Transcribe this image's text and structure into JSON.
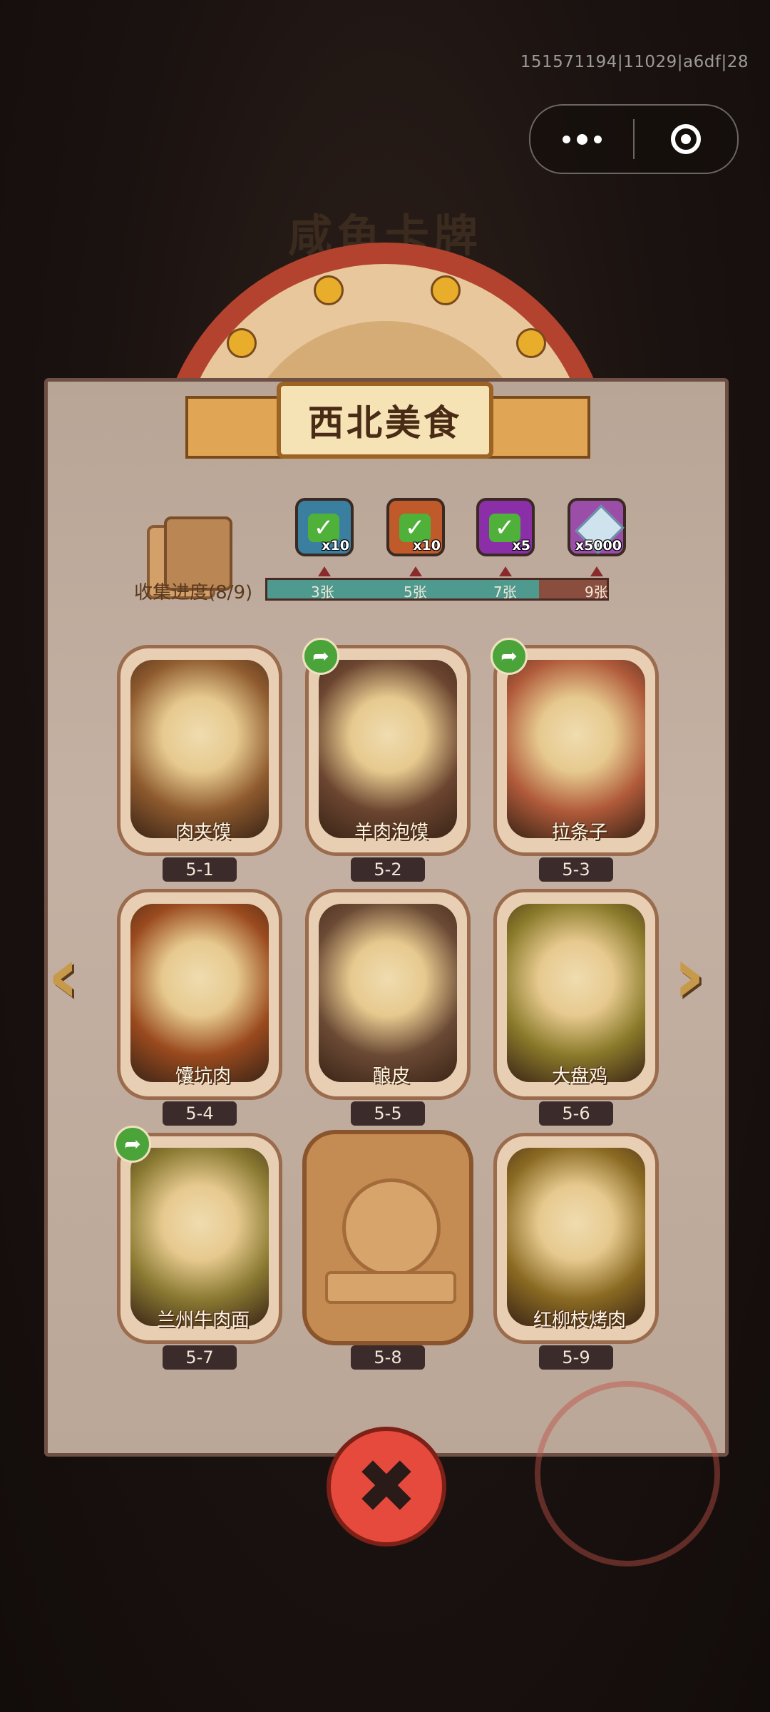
{
  "system": {
    "debug_id": "151571194|11029|a6df|28"
  },
  "capsule": {
    "more_icon": "more-dots-icon",
    "close_icon": "target-circle-icon"
  },
  "background": {
    "game_title": "咸鱼卡牌"
  },
  "panel": {
    "title": "西北美食"
  },
  "collection": {
    "label": "收集进度(8/9)",
    "collected": 8,
    "total": 9,
    "progress_fraction": 0.8,
    "rewards": [
      {
        "icon": "treasure-chest-icon",
        "qty": "x10",
        "claimed": true,
        "color": "#3a7fa0"
      },
      {
        "icon": "scroll-ticket-icon",
        "qty": "x10",
        "claimed": true,
        "color": "#c05a2a"
      },
      {
        "icon": "purple-orb-icon",
        "qty": "x5",
        "claimed": true,
        "color": "#8a2fa8"
      },
      {
        "icon": "crystal-gem-icon",
        "qty": "x5000",
        "claimed": false,
        "color": "#9a4ea8"
      }
    ],
    "milestones": [
      "3张",
      "5张",
      "7张",
      "9张"
    ]
  },
  "cards": [
    {
      "name": "肉夹馍",
      "num": "5-1",
      "shared": false,
      "color": "#8e5a2e"
    },
    {
      "name": "羊肉泡馍",
      "num": "5-2",
      "shared": true,
      "color": "#6b4530"
    },
    {
      "name": "拉条子",
      "num": "5-3",
      "shared": true,
      "color": "#b05a3a"
    },
    {
      "name": "馕坑肉",
      "num": "5-4",
      "shared": false,
      "color": "#9a4a1e"
    },
    {
      "name": "酿皮",
      "num": "5-5",
      "shared": false,
      "color": "#6b4a35"
    },
    {
      "name": "大盘鸡",
      "num": "5-6",
      "shared": false,
      "color": "#8a7a2a"
    },
    {
      "name": "兰州牛肉面",
      "num": "5-7",
      "shared": true,
      "color": "#8a7a32"
    },
    {
      "name": "",
      "num": "5-8",
      "shared": false,
      "locked": true,
      "color": "#c48b52"
    },
    {
      "name": "红柳枝烤肉",
      "num": "5-9",
      "shared": false,
      "color": "#8a6a22"
    }
  ],
  "nav": {
    "prev_icon": "chevron-left-icon",
    "next_icon": "chevron-right-icon"
  },
  "close": {
    "icon": "close-x-icon",
    "label": "✖"
  }
}
